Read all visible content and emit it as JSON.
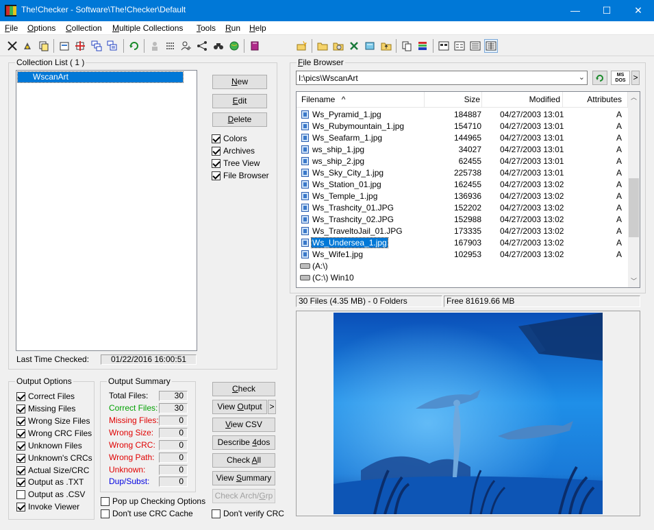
{
  "window": {
    "title": "The!Checker - Software\\The!Checker\\Default",
    "minimize_glyph": "—",
    "maximize_glyph": "☐",
    "close_glyph": "✕"
  },
  "menu": {
    "items": [
      {
        "accel": "F",
        "rest": "ile"
      },
      {
        "accel": "O",
        "rest": "ptions"
      },
      {
        "accel": "C",
        "rest": "ollection"
      },
      {
        "accel": "M",
        "rest": "ultiple Collections"
      },
      {
        "accel": "T",
        "rest": "ools"
      },
      {
        "accel": "R",
        "rest": "un"
      },
      {
        "accel": "H",
        "rest": "elp"
      }
    ]
  },
  "toolbar": {
    "icons": [
      "cut-icon",
      "run-icon",
      "copy-icon",
      "properties-icon",
      "options-icon",
      "multi-collection-icon",
      "multi-edit-icon",
      "refresh-icon",
      "user-icon",
      "scan-icon",
      "user-add-icon",
      "network-icon",
      "find-icon",
      "globe-icon",
      "book-icon",
      "new-folder-icon",
      "open-folder-icon",
      "cd-icon",
      "excel-icon",
      "explore-icon",
      "up-folder-icon",
      "copy-files-icon",
      "stack-icon",
      "large-icons-icon",
      "small-icons-icon",
      "list-view-icon",
      "details-view-icon"
    ]
  },
  "collection_list": {
    "label": "Collection List  ( 1 )",
    "items": [
      "WscanArt"
    ],
    "buttons": {
      "new": {
        "accel": "N",
        "rest": "ew"
      },
      "edit": {
        "accel": "E",
        "rest": "dit"
      },
      "delete": {
        "accel": "D",
        "rest": "elete"
      }
    },
    "checks": [
      {
        "label": "Colors",
        "checked": true
      },
      {
        "label": "Archives",
        "checked": true
      },
      {
        "label": "Tree View",
        "checked": true
      },
      {
        "label": "File Browser",
        "checked": true
      }
    ],
    "last_checked_label": "Last Time Checked:",
    "last_checked_value": "01/22/2016 16:00:51"
  },
  "output_options": {
    "label": "Output Options",
    "items": [
      {
        "label": "Correct Files",
        "checked": true
      },
      {
        "label": "Missing Files",
        "checked": true
      },
      {
        "label": "Wrong Size Files",
        "checked": true
      },
      {
        "label": "Wrong CRC Files",
        "checked": true
      },
      {
        "label": "Unknown Files",
        "checked": true
      },
      {
        "label": "Unknown's CRCs",
        "checked": true
      },
      {
        "label": "Actual Size/CRC",
        "checked": true
      },
      {
        "label": "Output as .TXT",
        "checked": true
      },
      {
        "label": "Output as .CSV",
        "checked": false
      },
      {
        "label": "Invoke Viewer",
        "checked": true
      }
    ]
  },
  "output_summary": {
    "label": "Output Summary",
    "rows": [
      {
        "label": "Total Files:",
        "value": "30",
        "color": "#000000"
      },
      {
        "label": "Correct Files:",
        "value": "30",
        "color": "#00a000"
      },
      {
        "label": "Missing Files:",
        "value": "0",
        "color": "#e00000"
      },
      {
        "label": "Wrong Size:",
        "value": "0",
        "color": "#e00000"
      },
      {
        "label": "Wrong CRC:",
        "value": "0",
        "color": "#e00000"
      },
      {
        "label": "Wrong Path:",
        "value": "0",
        "color": "#e00000"
      },
      {
        "label": "Unknown:",
        "value": "0",
        "color": "#e00000"
      },
      {
        "label": "Dup/Subst:",
        "value": "0",
        "color": "#0000e0"
      }
    ]
  },
  "run_buttons": {
    "check": {
      "pre": "",
      "accel": "C",
      "rest": "heck"
    },
    "view_output": {
      "pre": "View ",
      "accel": "O",
      "rest": "utput"
    },
    "view_output_arrow": ">",
    "view_csv": {
      "pre": "",
      "accel": "V",
      "rest": "iew CSV"
    },
    "describe": {
      "pre": "Describe ",
      "accel": "4",
      "rest": "dos"
    },
    "check_all": {
      "pre": "Check ",
      "accel": "A",
      "rest": "ll"
    },
    "view_summary": {
      "pre": "View ",
      "accel": "S",
      "rest": "ummary"
    },
    "check_arch": {
      "pre": "Check Arch/",
      "accel": "G",
      "rest": "rp"
    }
  },
  "bottom_checks": [
    {
      "label": "Pop up Checking Options",
      "checked": false
    },
    {
      "label": "Don't use CRC Cache",
      "checked": false
    },
    {
      "label": "Don't verify CRC",
      "checked": false
    }
  ],
  "file_browser": {
    "label_accel": "F",
    "label_rest": "ile Browser",
    "path": "I:\\pics\\WscanArt",
    "dos_label_top": "MS",
    "dos_label_bottom": "DOS",
    "columns": {
      "filename": "Filename",
      "size": "Size",
      "modified": "Modified",
      "attributes": "Attributes"
    },
    "files": [
      {
        "name": "Ws_Pyramid_1.jpg",
        "size": "184887",
        "modified": "04/27/2003 13:01",
        "attr": "A"
      },
      {
        "name": "Ws_Rubymountain_1.jpg",
        "size": "154710",
        "modified": "04/27/2003 13:01",
        "attr": "A"
      },
      {
        "name": "Ws_Seafarm_1.jpg",
        "size": "144965",
        "modified": "04/27/2003 13:01",
        "attr": "A"
      },
      {
        "name": "ws_ship_1.jpg",
        "size": "34027",
        "modified": "04/27/2003 13:01",
        "attr": "A"
      },
      {
        "name": "ws_ship_2.jpg",
        "size": "62455",
        "modified": "04/27/2003 13:01",
        "attr": "A"
      },
      {
        "name": "Ws_Sky_City_1.jpg",
        "size": "225738",
        "modified": "04/27/2003 13:01",
        "attr": "A"
      },
      {
        "name": "Ws_Station_01.jpg",
        "size": "162455",
        "modified": "04/27/2003 13:02",
        "attr": "A"
      },
      {
        "name": "Ws_Temple_1.jpg",
        "size": "136936",
        "modified": "04/27/2003 13:02",
        "attr": "A"
      },
      {
        "name": "Ws_Trashcity_01.JPG",
        "size": "152202",
        "modified": "04/27/2003 13:02",
        "attr": "A"
      },
      {
        "name": "Ws_Trashcity_02.JPG",
        "size": "152988",
        "modified": "04/27/2003 13:02",
        "attr": "A"
      },
      {
        "name": "Ws_TraveltoJail_01.JPG",
        "size": "173335",
        "modified": "04/27/2003 13:02",
        "attr": "A"
      },
      {
        "name": "Ws_Undersea_1.jpg",
        "size": "167903",
        "modified": "04/27/2003 13:02",
        "attr": "A",
        "selected": true
      },
      {
        "name": "Ws_Wife1.jpg",
        "size": "102953",
        "modified": "04/27/2003 13:02",
        "attr": "A"
      }
    ],
    "drives": [
      "(A:\\)",
      "(C:\\) Win10"
    ],
    "status_left": "30 Files (4.35 MB) - 0 Folders",
    "status_right": "Free 81619.66 MB",
    "scrollbar_up": "︿",
    "scrollbar_down": "﹀",
    "sort_glyph": "^"
  },
  "colors": {
    "titlebar": "#0078d7",
    "selection": "#0078d7",
    "correct": "#00a000",
    "error": "#e00000",
    "dup": "#0000e0"
  }
}
